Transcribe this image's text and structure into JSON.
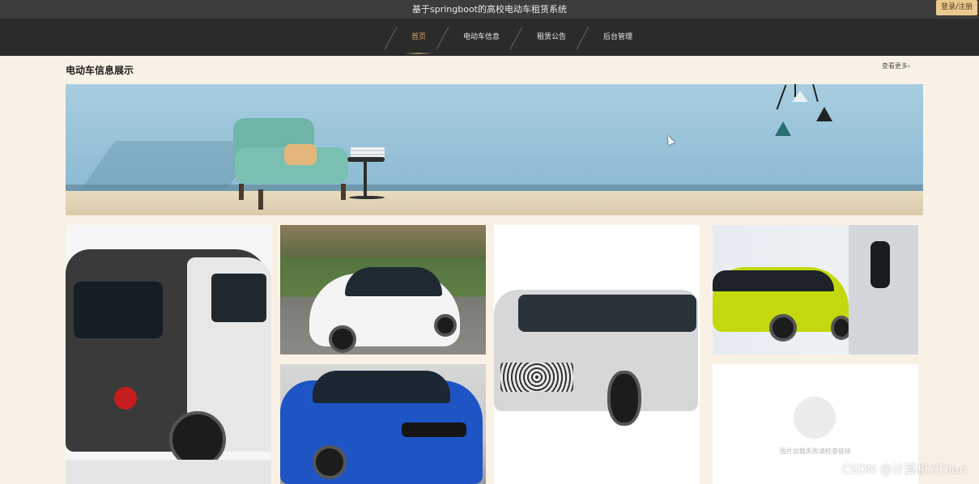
{
  "header": {
    "title": "基于springboot的高校电动车租赁系统",
    "login_label": "登录/注册"
  },
  "nav": {
    "items": [
      {
        "label": "首页",
        "active": true
      },
      {
        "label": "电动车信息",
        "active": false
      },
      {
        "label": "租赁公告",
        "active": false
      },
      {
        "label": "后台管理",
        "active": false
      }
    ]
  },
  "section": {
    "title": "电动车信息展示",
    "more_label": "查看更多›"
  },
  "placeholder": {
    "caption": "图片加载失败请检查链接"
  },
  "watermark": {
    "text": "CSDN @计算机YiDian"
  },
  "colors": {
    "nav_bg": "#2b2b2b",
    "active_nav": "#d9a75e",
    "page_bg": "#faf1e6",
    "login_bg": "#e8c98f"
  },
  "icons": [
    "cursor-icon",
    "image-placeholder-icon"
  ]
}
